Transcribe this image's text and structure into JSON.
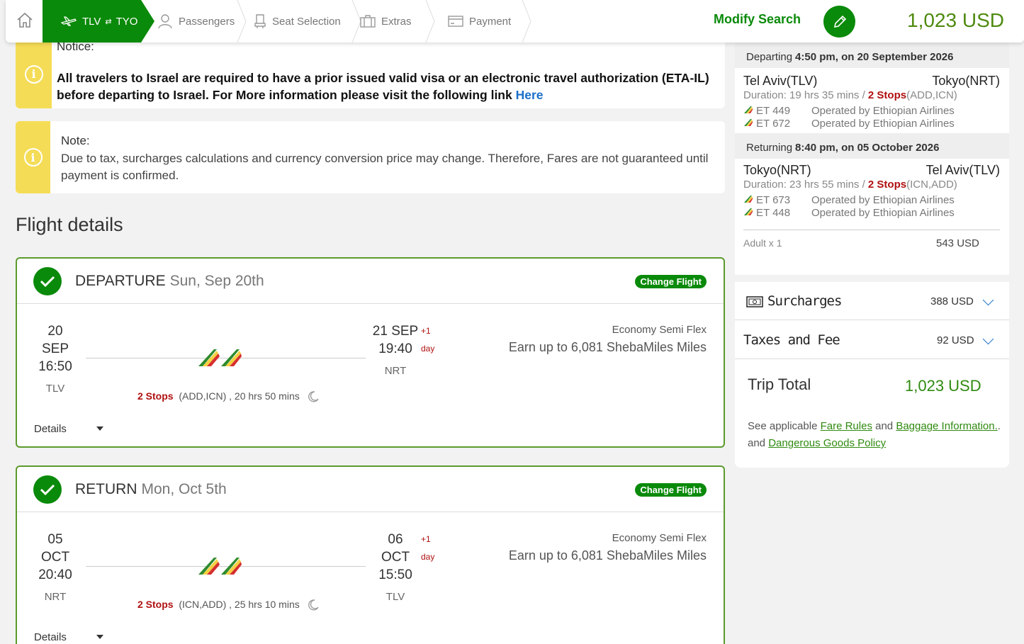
{
  "topbar": {
    "route_from": "TLV",
    "route_to": "TYO",
    "steps": [
      "Passengers",
      "Seat Selection",
      "Extras",
      "Payment"
    ],
    "modify_label": "Modify Search",
    "total_price": "1,023 USD"
  },
  "notice1": {
    "title": "Notice:",
    "body": "All travelers to Israel are required to have a prior issued valid visa or an electronic travel authorization (ETA-IL) before departing to Israel. For More information please visit the following link",
    "link": "Here"
  },
  "notice2": {
    "title": "Note:",
    "body": "Due to tax, surcharges calculations and currency conversion price may change. Therefore, Fares are not guaranteed until payment is confirmed."
  },
  "flight_details_title": "Flight details",
  "departure": {
    "direction": "DEPARTURE",
    "date": "Sun, Sep 20th",
    "change_label": "Change Flight",
    "dep_day": "20",
    "dep_month": "SEP",
    "dep_time": "16:50",
    "dep_code": "TLV",
    "arr_daymonth": "21 SEP",
    "arr_time": "19:40",
    "arr_code": "NRT",
    "plus": "+1",
    "plus_day": "day",
    "stops_label": "2 Stops",
    "stops_detail": "(ADD,ICN) , 20 hrs 50 mins",
    "cabin": "Economy Semi Flex",
    "miles": "Earn up to 6,081 ShebaMiles Miles",
    "details_label": "Details"
  },
  "return": {
    "direction": "RETURN",
    "date": "Mon, Oct 5th",
    "change_label": "Change Flight",
    "dep_day": "05",
    "dep_month": "OCT",
    "dep_time": "20:40",
    "dep_code": "NRT",
    "arr_day": "06",
    "arr_month": "OCT",
    "arr_time": "15:50",
    "arr_code": "TLV",
    "plus": "+1",
    "plus_day": "day",
    "stops_label": "2 Stops",
    "stops_detail": "(ICN,ADD) , 25 hrs 10 mins",
    "cabin": "Economy Semi Flex",
    "miles": "Earn up to 6,081 ShebaMiles Miles",
    "details_label": "Details"
  },
  "summary": {
    "departing_label": "Departing",
    "departing_when": "4:50 pm, on 20 September 2026",
    "out_from": "Tel Aviv(TLV)",
    "out_to": "Tokyo(NRT)",
    "out_duration": "Duration: 19 hrs 35 mins /",
    "out_stops": "2 Stops",
    "out_stops_via": "(ADD,ICN)",
    "out_flights": [
      {
        "num": "ET 449",
        "op": "Operated by Ethiopian Airlines"
      },
      {
        "num": "ET 672",
        "op": "Operated by Ethiopian Airlines"
      }
    ],
    "returning_label": "Returning",
    "returning_when": "8:40 pm, on 05 October 2026",
    "ret_from": "Tokyo(NRT)",
    "ret_to": "Tel Aviv(TLV)",
    "ret_duration": "Duration: 23 hrs 55 mins /",
    "ret_stops": "2 Stops",
    "ret_stops_via": "(ICN,ADD)",
    "ret_flights": [
      {
        "num": "ET 673",
        "op": "Operated by Ethiopian Airlines"
      },
      {
        "num": "ET 448",
        "op": "Operated by Ethiopian Airlines"
      }
    ],
    "adult_label": "Adult x 1",
    "adult_price": "543 USD",
    "surcharges_label": "Surcharges",
    "surcharges_value": "388 USD",
    "taxes_label": "Taxes and Fee",
    "taxes_value": "92 USD",
    "trip_total_label": "Trip Total",
    "trip_total_value": "1,023 USD",
    "fine_1": "See applicable",
    "fare_rules": "Fare Rules",
    "fine_and": "and",
    "baggage": "Baggage Information.",
    "fine_dot": ".",
    "fine_and2": "and",
    "dangerous": "Dangerous Goods Policy"
  },
  "colors": {
    "brand_green": "#0a8a0a",
    "notice_yellow": "#f5dc56",
    "stop_red": "#b01010"
  }
}
